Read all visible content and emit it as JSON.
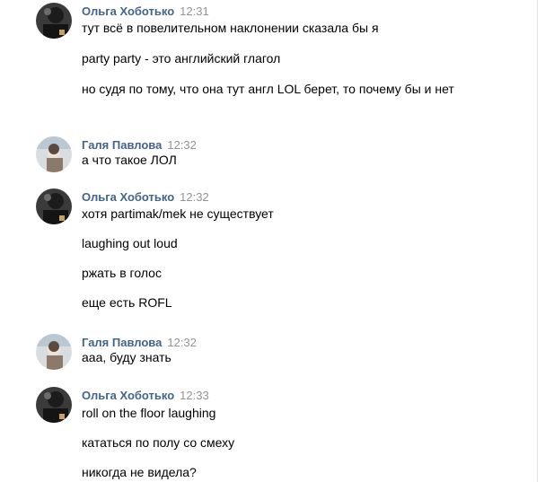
{
  "colors": {
    "author": "#42648b",
    "time": "#939393",
    "text": "#000000",
    "divider": "#dfe3e8"
  },
  "messages": [
    {
      "author": "Ольга Хоботько",
      "time": "12:31",
      "avatar_icon": "user-avatar-dark-icon",
      "lines": [
        "тут всё в повелительном наклонении сказала бы я",
        "party party - это английский глагол",
        "но судя по тому, что она тут англ LOL берет, то почему бы и нет"
      ]
    },
    {
      "author": "Галя Павлова",
      "time": "12:32",
      "avatar_icon": "user-avatar-light-icon",
      "lines": [
        "а что такое ЛОЛ"
      ]
    },
    {
      "author": "Ольга Хоботько",
      "time": "12:32",
      "avatar_icon": "user-avatar-dark-icon",
      "lines": [
        "хотя partimak/mek не существует",
        "laughing out loud",
        "ржать в голос",
        "еще есть ROFL"
      ]
    },
    {
      "author": "Галя Павлова",
      "time": "12:32",
      "avatar_icon": "user-avatar-light-icon",
      "lines": [
        "ааа, буду знать"
      ]
    },
    {
      "author": "Ольга Хоботько",
      "time": "12:33",
      "avatar_icon": "user-avatar-dark-icon",
      "lines": [
        "roll on the floor laughing",
        "кататься по полу со смеху",
        "никогда не видела?"
      ]
    }
  ]
}
